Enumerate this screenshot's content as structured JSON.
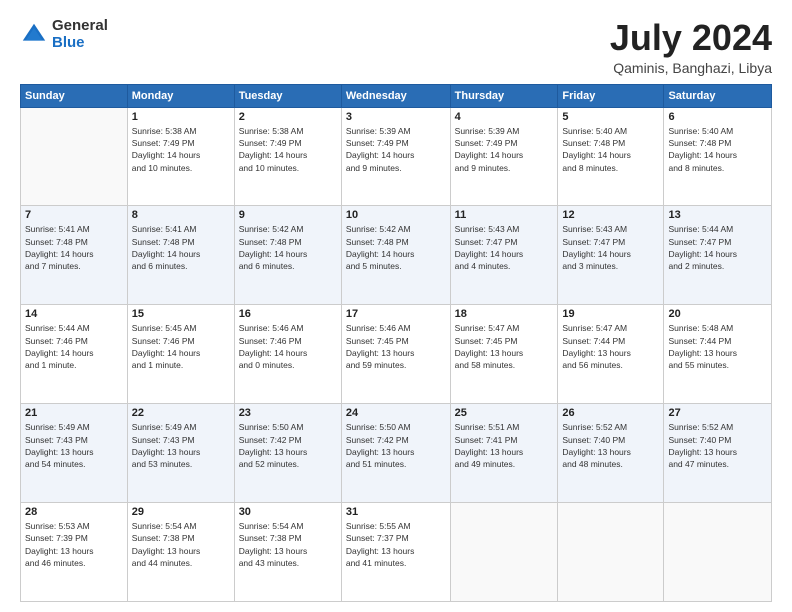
{
  "header": {
    "logo_line1": "General",
    "logo_line2": "Blue",
    "month": "July 2024",
    "location": "Qaminis, Banghazi, Libya"
  },
  "weekdays": [
    "Sunday",
    "Monday",
    "Tuesday",
    "Wednesday",
    "Thursday",
    "Friday",
    "Saturday"
  ],
  "weeks": [
    [
      {
        "day": "",
        "info": ""
      },
      {
        "day": "1",
        "info": "Sunrise: 5:38 AM\nSunset: 7:49 PM\nDaylight: 14 hours\nand 10 minutes."
      },
      {
        "day": "2",
        "info": "Sunrise: 5:38 AM\nSunset: 7:49 PM\nDaylight: 14 hours\nand 10 minutes."
      },
      {
        "day": "3",
        "info": "Sunrise: 5:39 AM\nSunset: 7:49 PM\nDaylight: 14 hours\nand 9 minutes."
      },
      {
        "day": "4",
        "info": "Sunrise: 5:39 AM\nSunset: 7:49 PM\nDaylight: 14 hours\nand 9 minutes."
      },
      {
        "day": "5",
        "info": "Sunrise: 5:40 AM\nSunset: 7:48 PM\nDaylight: 14 hours\nand 8 minutes."
      },
      {
        "day": "6",
        "info": "Sunrise: 5:40 AM\nSunset: 7:48 PM\nDaylight: 14 hours\nand 8 minutes."
      }
    ],
    [
      {
        "day": "7",
        "info": "Sunrise: 5:41 AM\nSunset: 7:48 PM\nDaylight: 14 hours\nand 7 minutes."
      },
      {
        "day": "8",
        "info": "Sunrise: 5:41 AM\nSunset: 7:48 PM\nDaylight: 14 hours\nand 6 minutes."
      },
      {
        "day": "9",
        "info": "Sunrise: 5:42 AM\nSunset: 7:48 PM\nDaylight: 14 hours\nand 6 minutes."
      },
      {
        "day": "10",
        "info": "Sunrise: 5:42 AM\nSunset: 7:48 PM\nDaylight: 14 hours\nand 5 minutes."
      },
      {
        "day": "11",
        "info": "Sunrise: 5:43 AM\nSunset: 7:47 PM\nDaylight: 14 hours\nand 4 minutes."
      },
      {
        "day": "12",
        "info": "Sunrise: 5:43 AM\nSunset: 7:47 PM\nDaylight: 14 hours\nand 3 minutes."
      },
      {
        "day": "13",
        "info": "Sunrise: 5:44 AM\nSunset: 7:47 PM\nDaylight: 14 hours\nand 2 minutes."
      }
    ],
    [
      {
        "day": "14",
        "info": "Sunrise: 5:44 AM\nSunset: 7:46 PM\nDaylight: 14 hours\nand 1 minute."
      },
      {
        "day": "15",
        "info": "Sunrise: 5:45 AM\nSunset: 7:46 PM\nDaylight: 14 hours\nand 1 minute."
      },
      {
        "day": "16",
        "info": "Sunrise: 5:46 AM\nSunset: 7:46 PM\nDaylight: 14 hours\nand 0 minutes."
      },
      {
        "day": "17",
        "info": "Sunrise: 5:46 AM\nSunset: 7:45 PM\nDaylight: 13 hours\nand 59 minutes."
      },
      {
        "day": "18",
        "info": "Sunrise: 5:47 AM\nSunset: 7:45 PM\nDaylight: 13 hours\nand 58 minutes."
      },
      {
        "day": "19",
        "info": "Sunrise: 5:47 AM\nSunset: 7:44 PM\nDaylight: 13 hours\nand 56 minutes."
      },
      {
        "day": "20",
        "info": "Sunrise: 5:48 AM\nSunset: 7:44 PM\nDaylight: 13 hours\nand 55 minutes."
      }
    ],
    [
      {
        "day": "21",
        "info": "Sunrise: 5:49 AM\nSunset: 7:43 PM\nDaylight: 13 hours\nand 54 minutes."
      },
      {
        "day": "22",
        "info": "Sunrise: 5:49 AM\nSunset: 7:43 PM\nDaylight: 13 hours\nand 53 minutes."
      },
      {
        "day": "23",
        "info": "Sunrise: 5:50 AM\nSunset: 7:42 PM\nDaylight: 13 hours\nand 52 minutes."
      },
      {
        "day": "24",
        "info": "Sunrise: 5:50 AM\nSunset: 7:42 PM\nDaylight: 13 hours\nand 51 minutes."
      },
      {
        "day": "25",
        "info": "Sunrise: 5:51 AM\nSunset: 7:41 PM\nDaylight: 13 hours\nand 49 minutes."
      },
      {
        "day": "26",
        "info": "Sunrise: 5:52 AM\nSunset: 7:40 PM\nDaylight: 13 hours\nand 48 minutes."
      },
      {
        "day": "27",
        "info": "Sunrise: 5:52 AM\nSunset: 7:40 PM\nDaylight: 13 hours\nand 47 minutes."
      }
    ],
    [
      {
        "day": "28",
        "info": "Sunrise: 5:53 AM\nSunset: 7:39 PM\nDaylight: 13 hours\nand 46 minutes."
      },
      {
        "day": "29",
        "info": "Sunrise: 5:54 AM\nSunset: 7:38 PM\nDaylight: 13 hours\nand 44 minutes."
      },
      {
        "day": "30",
        "info": "Sunrise: 5:54 AM\nSunset: 7:38 PM\nDaylight: 13 hours\nand 43 minutes."
      },
      {
        "day": "31",
        "info": "Sunrise: 5:55 AM\nSunset: 7:37 PM\nDaylight: 13 hours\nand 41 minutes."
      },
      {
        "day": "",
        "info": ""
      },
      {
        "day": "",
        "info": ""
      },
      {
        "day": "",
        "info": ""
      }
    ]
  ]
}
